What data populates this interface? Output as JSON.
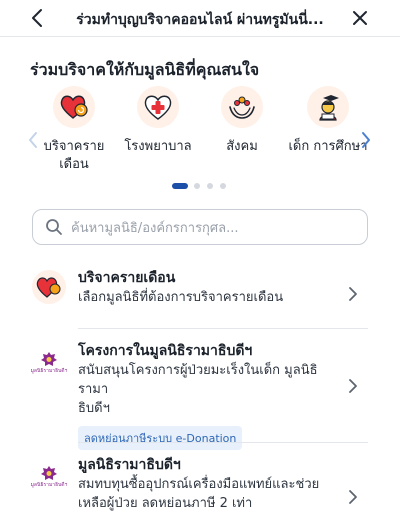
{
  "header": {
    "title": "ร่วมทำบุญบริจาคออนไลน์ ผ่านทรูมันนี่...",
    "back_icon": "arrow-left-icon",
    "close_icon": "close-icon"
  },
  "section": {
    "title": "ร่วมบริจาคให้กับมูลนิธิที่คุณสนใจ"
  },
  "categories": [
    {
      "label": "บริจาครายเดือน",
      "icon": "heart-refresh-icon"
    },
    {
      "label": "โรงพยาบาล",
      "icon": "medical-cross-icon"
    },
    {
      "label": "สังคม",
      "icon": "hands-people-icon"
    },
    {
      "label": "เด็ก การศึกษา",
      "icon": "student-icon"
    }
  ],
  "pagination": {
    "total": 4,
    "active": 1
  },
  "search": {
    "placeholder": "ค้นหามูลนิธิ/องค์กรการกุศล...",
    "icon": "search-icon"
  },
  "list": [
    {
      "title": "บริจาครายเดือน",
      "subtitle": "เลือกมูลนิธิที่ต้องการบริจาครายเดือน",
      "icon": "heart-refresh-icon"
    },
    {
      "title": "โครงการในมูลนิธิรามาธิบดีฯ",
      "subtitle_line1": "สนับสนุนโครงการผู้ป่วยมะเร็งในเด็ก มูลนิธิรามา",
      "subtitle_line2": "ธิบดีฯ",
      "tag": "ลดหย่อนภาษีระบบ e-Donation",
      "logo_caption": "มูลนิธิรามาธิบดีฯ",
      "icon": "foundation-logo-icon"
    },
    {
      "title": "มูลนิธิรามาธิบดีฯ",
      "subtitle_line1": "สมทบทุนซื้ออุปกรณ์เครื่องมือแพทย์และช่วย",
      "subtitle_line2": "เหลือผู้ป่วย ลดหย่อนภาษี 2 เท่า",
      "logo_caption": "มูลนิธิรามาธิบดีฯ",
      "icon": "foundation-logo-icon"
    }
  ],
  "colors": {
    "accent": "#1c4fa7",
    "heart": "#e8323a",
    "icon_bg": "#fff0e8",
    "tag_bg": "#e8f1fb",
    "tag_text": "#2e67b5"
  }
}
